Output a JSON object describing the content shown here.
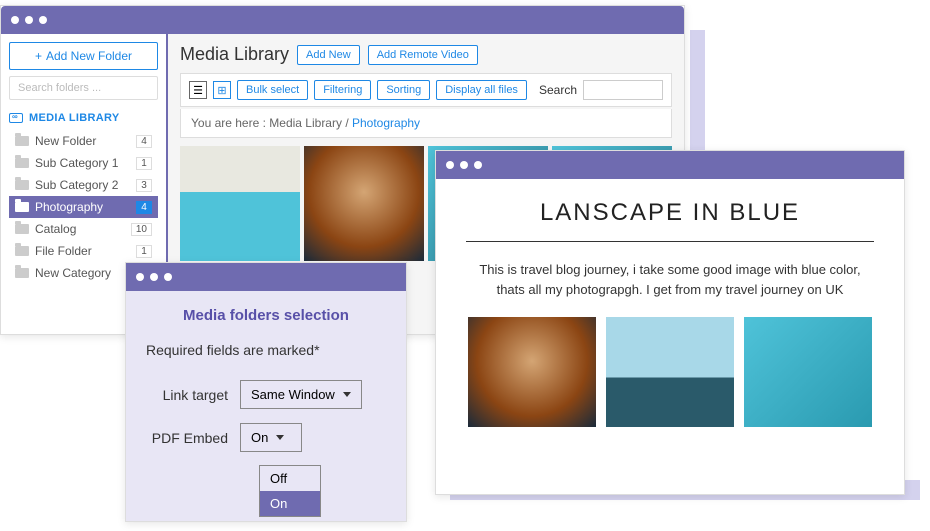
{
  "main": {
    "sidebar": {
      "add_folder": "Add New Folder",
      "search_placeholder": "Search folders ...",
      "lib_label": "MEDIA LIBRARY",
      "folders": [
        {
          "name": "New Folder",
          "count": "4",
          "active": false
        },
        {
          "name": "Sub Category 1",
          "count": "1",
          "active": false
        },
        {
          "name": "Sub Category 2",
          "count": "3",
          "active": false
        },
        {
          "name": "Photography",
          "count": "4",
          "active": true
        },
        {
          "name": "Catalog",
          "count": "10",
          "active": false
        },
        {
          "name": "File Folder",
          "count": "1",
          "active": false
        },
        {
          "name": "New Category",
          "count": "",
          "active": false
        }
      ]
    },
    "content": {
      "title": "Media Library",
      "add_new": "Add New",
      "add_remote": "Add Remote Video",
      "toolbar": {
        "bulk": "Bulk select",
        "filter": "Filtering",
        "sort": "Sorting",
        "display": "Display all files",
        "search_label": "Search"
      },
      "breadcrumb": {
        "prefix": "You are here  :  ",
        "root": "Media Library",
        "sep": "  /  ",
        "current": "Photography"
      }
    }
  },
  "modal": {
    "title": "Media folders selection",
    "subtitle": "Required fields are marked*",
    "link_target_label": "Link target",
    "link_target_value": "Same Window",
    "pdf_embed_label": "PDF Embed",
    "pdf_embed_value": "On",
    "options": {
      "off": "Off",
      "on": "On"
    }
  },
  "blog": {
    "title": "LANSCAPE IN BLUE",
    "text": "This is travel blog journey, i take some good image with blue color, thats all my photograpgh. I get from my travel journey on UK"
  }
}
